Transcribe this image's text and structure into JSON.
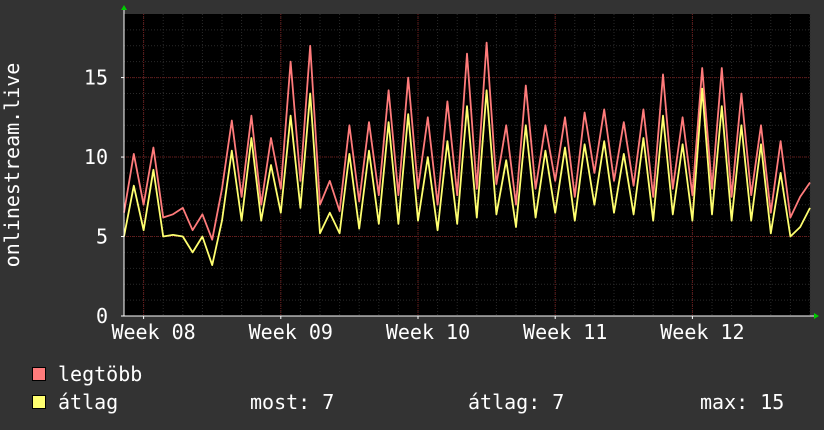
{
  "colors": {
    "background": "#333333",
    "plot_background": "#000000",
    "grid_minor": "#2a2a2a",
    "grid_major": "#6e1a1a",
    "axis": "#ffffff",
    "max_series": "#ff7b7b",
    "avg_series": "#ffff70",
    "arrow": "#00cc00"
  },
  "legend": {
    "max_label": "legtöbb",
    "avg_label": "átlag"
  },
  "stats": {
    "current": "most: 7",
    "average": "átlag: 7",
    "maximum": "max: 15"
  },
  "chart_data": {
    "type": "line",
    "ylabel": "onlinestream.live",
    "ylim": [
      0,
      19
    ],
    "yticks": [
      0,
      5,
      10,
      15
    ],
    "xlim": [
      0,
      35
    ],
    "xticks": [
      {
        "x": 1,
        "label": "Week 08"
      },
      {
        "x": 8,
        "label": "Week 09"
      },
      {
        "x": 15,
        "label": "Week 10"
      },
      {
        "x": 22,
        "label": "Week 11"
      },
      {
        "x": 29,
        "label": "Week 12"
      }
    ],
    "grid": true,
    "legend_position": "bottom-left",
    "series": [
      {
        "name": "legtöbb",
        "color": "#ff7b7b",
        "x": [
          0.0,
          0.5,
          1.0,
          1.5,
          2.0,
          2.5,
          3.0,
          3.5,
          4.0,
          4.5,
          5.0,
          5.5,
          6.0,
          6.5,
          7.0,
          7.5,
          8.0,
          8.5,
          9.0,
          9.5,
          10.0,
          10.5,
          11.0,
          11.5,
          12.0,
          12.5,
          13.0,
          13.5,
          14.0,
          14.5,
          15.0,
          15.5,
          16.0,
          16.5,
          17.0,
          17.5,
          18.0,
          18.5,
          19.0,
          19.5,
          20.0,
          20.5,
          21.0,
          21.5,
          22.0,
          22.5,
          23.0,
          23.5,
          24.0,
          24.5,
          25.0,
          25.5,
          26.0,
          26.5,
          27.0,
          27.5,
          28.0,
          28.5,
          29.0,
          29.5,
          30.0,
          30.5,
          31.0,
          31.5,
          32.0,
          32.5,
          33.0,
          33.5,
          34.0,
          34.5,
          35.0
        ],
        "values": [
          6.5,
          10.2,
          7.0,
          10.6,
          6.2,
          6.4,
          6.8,
          5.4,
          6.4,
          4.8,
          8.0,
          12.3,
          7.5,
          12.6,
          7.0,
          11.2,
          8.0,
          16.0,
          8.5,
          17.0,
          7.0,
          8.5,
          6.6,
          12.0,
          7.2,
          12.2,
          7.6,
          14.2,
          7.6,
          15.0,
          8.0,
          12.5,
          7.0,
          13.5,
          7.6,
          16.5,
          8.0,
          17.2,
          8.3,
          12.0,
          7.0,
          14.5,
          8.0,
          12.0,
          8.5,
          12.5,
          7.5,
          12.8,
          9.0,
          13.0,
          8.5,
          12.2,
          8.2,
          13.0,
          7.5,
          15.2,
          8.0,
          12.5,
          7.6,
          15.6,
          8.0,
          15.6,
          7.5,
          14.0,
          7.6,
          12.0,
          6.5,
          11.0,
          6.2,
          7.5,
          8.4
        ]
      },
      {
        "name": "átlag",
        "color": "#ffff70",
        "x": [
          0.0,
          0.5,
          1.0,
          1.5,
          2.0,
          2.5,
          3.0,
          3.5,
          4.0,
          4.5,
          5.0,
          5.5,
          6.0,
          6.5,
          7.0,
          7.5,
          8.0,
          8.5,
          9.0,
          9.5,
          10.0,
          10.5,
          11.0,
          11.5,
          12.0,
          12.5,
          13.0,
          13.5,
          14.0,
          14.5,
          15.0,
          15.5,
          16.0,
          16.5,
          17.0,
          17.5,
          18.0,
          18.5,
          19.0,
          19.5,
          20.0,
          20.5,
          21.0,
          21.5,
          22.0,
          22.5,
          23.0,
          23.5,
          24.0,
          24.5,
          25.0,
          25.5,
          26.0,
          26.5,
          27.0,
          27.5,
          28.0,
          28.5,
          29.0,
          29.5,
          30.0,
          30.5,
          31.0,
          31.5,
          32.0,
          32.5,
          33.0,
          33.5,
          34.0,
          34.5,
          35.0
        ],
        "values": [
          5.0,
          8.2,
          5.4,
          9.2,
          5.0,
          5.1,
          5.0,
          4.0,
          5.0,
          3.2,
          6.0,
          10.4,
          6.0,
          11.2,
          6.0,
          9.5,
          6.5,
          12.6,
          6.8,
          14.0,
          5.2,
          6.5,
          5.2,
          10.2,
          5.5,
          10.4,
          5.8,
          12.2,
          5.8,
          12.7,
          6.0,
          10.0,
          5.4,
          11.0,
          5.8,
          13.2,
          6.2,
          14.2,
          6.4,
          9.8,
          5.6,
          12.0,
          6.2,
          10.4,
          6.5,
          10.6,
          6.0,
          10.8,
          7.0,
          11.0,
          6.5,
          10.2,
          6.4,
          11.2,
          6.0,
          12.6,
          6.4,
          10.8,
          6.0,
          14.3,
          6.4,
          13.2,
          6.0,
          12.0,
          6.0,
          10.8,
          5.2,
          9.0,
          5.0,
          5.6,
          6.8
        ]
      }
    ]
  }
}
